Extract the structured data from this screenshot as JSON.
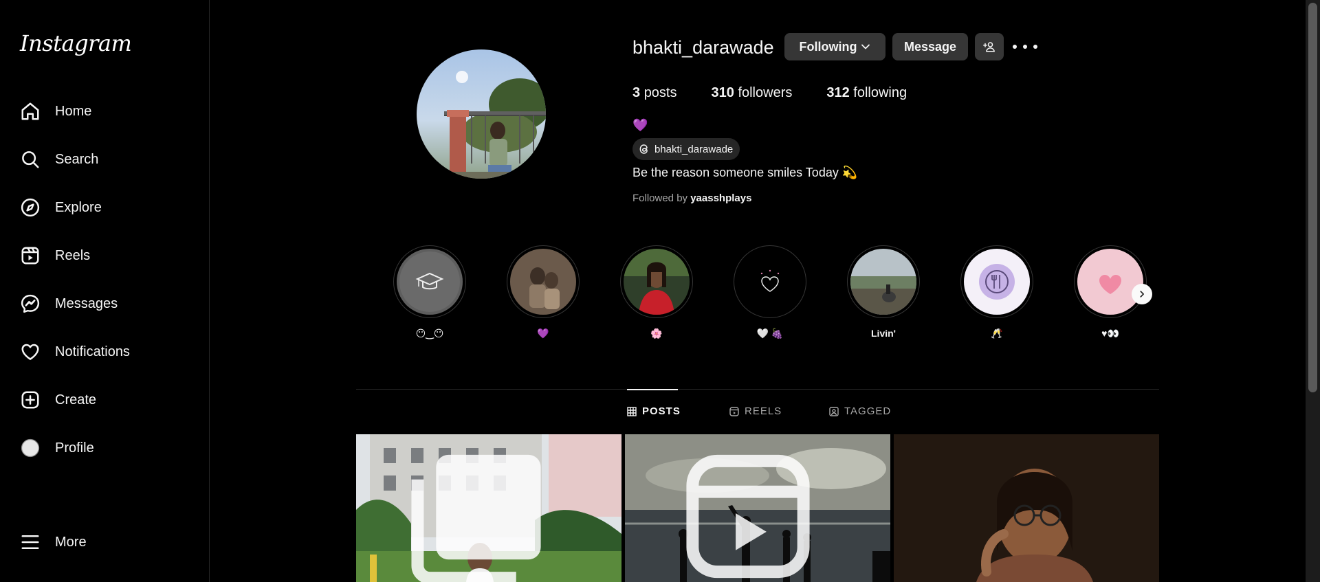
{
  "brand": {
    "logo_text": "Instagram"
  },
  "sidebar": {
    "items": [
      {
        "label": "Home",
        "icon": "home-icon"
      },
      {
        "label": "Search",
        "icon": "search-icon"
      },
      {
        "label": "Explore",
        "icon": "compass-icon"
      },
      {
        "label": "Reels",
        "icon": "reels-icon"
      },
      {
        "label": "Messages",
        "icon": "messenger-icon"
      },
      {
        "label": "Notifications",
        "icon": "heart-icon"
      },
      {
        "label": "Create",
        "icon": "plus-square-icon"
      },
      {
        "label": "Profile",
        "icon": "avatar-icon"
      }
    ],
    "more_label": "More"
  },
  "profile": {
    "username": "bhakti_darawade",
    "following_button": "Following",
    "message_button": "Message",
    "stats": {
      "posts_count": "3",
      "posts_label": "posts",
      "followers_count": "310",
      "followers_label": "followers",
      "following_count": "312",
      "following_label": "following"
    },
    "bio_emoji": "💜",
    "threads_handle": "bhakti_darawade",
    "bio_text": "Be the reason someone smiles Today 💫",
    "followed_by_prefix": "Followed by",
    "followed_by_user": "yaasshplays"
  },
  "highlights": [
    {
      "label": "😶‿😶",
      "icon": "graduation-cap-icon"
    },
    {
      "label": "💜",
      "icon": "photo-icon"
    },
    {
      "label": "🌸",
      "icon": "photo-icon"
    },
    {
      "label": "🤍 🍇",
      "icon": "heart-doodle-icon"
    },
    {
      "label": "Livin'",
      "icon": "photo-icon"
    },
    {
      "label": "🥂",
      "icon": "cutlery-icon"
    },
    {
      "label": "♥👀",
      "icon": "heart-icon"
    }
  ],
  "tabs": [
    {
      "label": "POSTS",
      "icon": "grid-icon",
      "active": true
    },
    {
      "label": "REELS",
      "icon": "reels-icon",
      "active": false
    },
    {
      "label": "TAGGED",
      "icon": "tag-user-icon",
      "active": false
    }
  ],
  "posts": [
    {
      "type": "carousel",
      "icon": "multi-photo-icon"
    },
    {
      "type": "reel",
      "icon": "reels-icon"
    },
    {
      "type": "photo",
      "icon": ""
    }
  ],
  "colors": {
    "background": "#000000",
    "button": "#363636",
    "accent_purple": "#8e4ad1",
    "muted_text": "#a8a8a8"
  }
}
